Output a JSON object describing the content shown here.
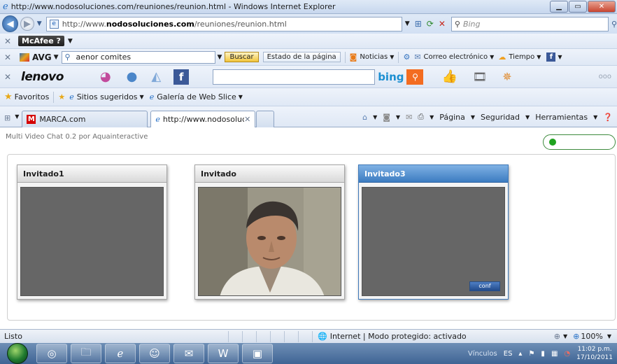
{
  "window": {
    "title": "http://www.nodosoluciones.com/reuniones/reunion.html - Windows Internet Explorer",
    "controls": [
      "minimize",
      "maximize",
      "close"
    ]
  },
  "address": {
    "prefix": "http://www.",
    "domain": "nodosoluciones.com",
    "path": "/reuniones/reunion.html",
    "search_placeholder": "Bing"
  },
  "mcafee": {
    "label": "McAfee",
    "help": "?"
  },
  "avg": {
    "logo": "AVG",
    "search_value": "aenor comites",
    "buscar": "Buscar",
    "estado": "Estado de la página",
    "noticias": "Noticias",
    "correo": "Correo electrónico",
    "tiempo": "Tiempo"
  },
  "lenovo": {
    "logo": "lenovo",
    "bing": "bing",
    "extra": "ooo"
  },
  "favorites": {
    "label": "Favoritos",
    "sugeridos": "Sitios sugeridos",
    "galeria": "Galería de Web Slice"
  },
  "tabs": [
    {
      "label": "MARCA.com"
    },
    {
      "label": "http://www.nodosoluci..."
    }
  ],
  "commandbar": {
    "pagina": "Página",
    "seguridad": "Seguridad",
    "herramientas": "Herramientas"
  },
  "app": {
    "title": "Multi Video Chat 0.2 por Aquainteractive",
    "panels": [
      {
        "name": "Invitado1",
        "state": "empty"
      },
      {
        "name": "Invitado",
        "state": "webcam"
      },
      {
        "name": "Invitado3",
        "state": "active",
        "button": "conf"
      }
    ]
  },
  "status": {
    "left": "Listo",
    "zone": "Internet | Modo protegido: activado",
    "zoom": "100%"
  },
  "taskbar": {
    "vinculos": "Vínculos",
    "lang": "ES",
    "time": "11:02 p.m.",
    "date": "17/10/2011"
  },
  "colors": {
    "accent": "#3c7cc1",
    "toggle": "#1fa31f",
    "video_bg": "#666666"
  }
}
